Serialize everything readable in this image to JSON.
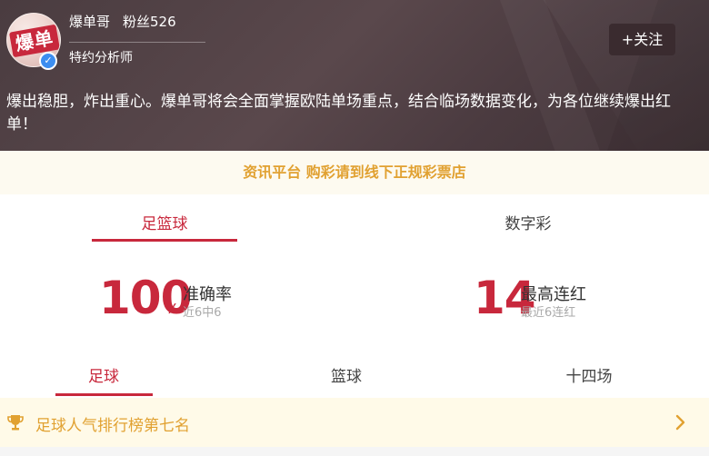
{
  "profile": {
    "avatar_text": "爆单",
    "name": "爆单哥",
    "fans": "粉丝526",
    "title": "特约分析师",
    "follow_label": "+关注",
    "intro": "爆出稳胆，炸出重心。爆单哥将会全面掌握欧陆单场重点，结合临场数据变化，为各位继续爆出红单！"
  },
  "notice": "资讯平台 购彩请到线下正规彩票店",
  "main_tabs": [
    {
      "label": "足篮球",
      "active": true
    },
    {
      "label": "数字彩",
      "active": false
    }
  ],
  "stats": {
    "accuracy": {
      "value": "100",
      "unit": "%",
      "label": "准确率",
      "sub": "近6中6"
    },
    "streak": {
      "value": "14",
      "label": "最高连红",
      "sub": "最近6连红"
    }
  },
  "sub_tabs": [
    {
      "label": "足球",
      "active": true
    },
    {
      "label": "篮球",
      "active": false
    },
    {
      "label": "十四场",
      "active": false
    }
  ],
  "ranking": {
    "text": "足球人气排行榜第七名",
    "icon": "trophy-icon",
    "arrow_icon": "chevron-right-icon"
  },
  "colors": {
    "accent": "#c8283c",
    "gold": "#e1a131",
    "header_bg": "#4a3c40"
  }
}
